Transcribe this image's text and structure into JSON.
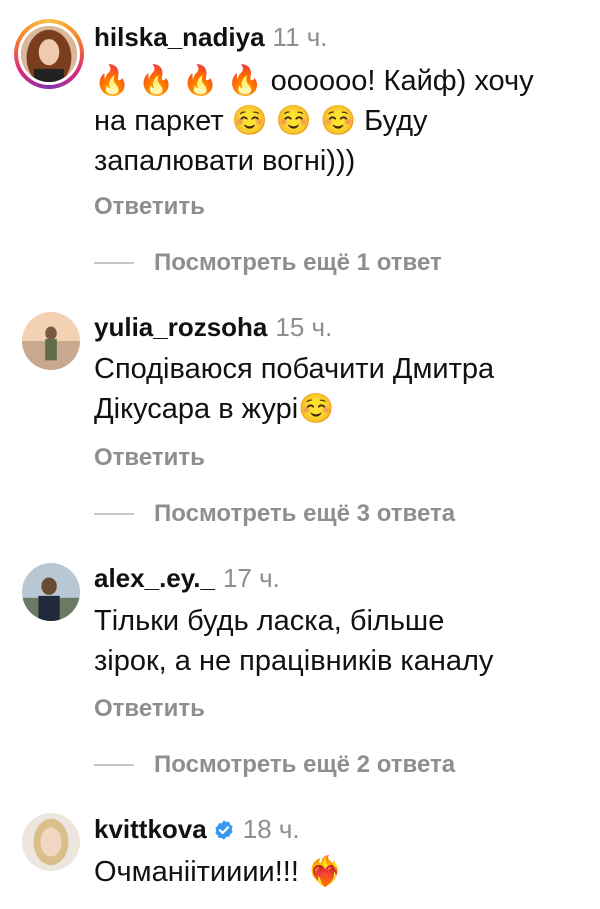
{
  "comments": [
    {
      "username": "hilska_nadiya",
      "time": "11 ч.",
      "text_lines": [
        "🔥 🔥 🔥 🔥 оооооо! Кайф) хочу",
        "на паркет ☺️ ☺️ ☺️ Буду",
        "запалювати вогні)))"
      ],
      "reply": "Ответить",
      "more_replies": "Посмотреть ещё 1 ответ",
      "has_story": true,
      "verified": false
    },
    {
      "username": "yulia_rozsoha",
      "time": "15 ч.",
      "text_lines": [
        "Сподіваюся побачити Дмитра",
        "Дікусара в журі☺️"
      ],
      "reply": "Ответить",
      "more_replies": "Посмотреть ещё 3 ответа",
      "has_story": false,
      "verified": false
    },
    {
      "username": "alex_.ey._",
      "time": "17 ч.",
      "text_lines": [
        "Тільки будь ласка, більше",
        "зірок, а не працівників каналу"
      ],
      "reply": "Ответить",
      "more_replies": "Посмотреть ещё 2 ответа",
      "has_story": false,
      "verified": false
    },
    {
      "username": "kvittkova",
      "time": "18 ч.",
      "text_lines": [
        "Очманіітииии!!! ❤️‍🔥"
      ],
      "has_story": false,
      "verified": true,
      "colors": {
        "verified": "#3897f0"
      }
    }
  ]
}
